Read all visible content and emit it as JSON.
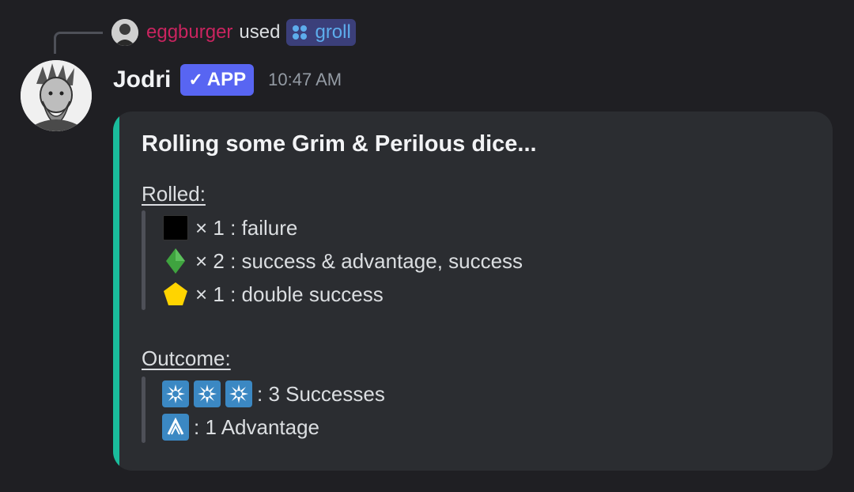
{
  "reply": {
    "username": "eggburger",
    "used_text": "used",
    "command": "groll",
    "user_color": "#c9245f",
    "command_color": "#5dadec"
  },
  "message": {
    "author": "Jodri",
    "badge": "APP",
    "badge_icon": "checkmark-icon",
    "timestamp": "10:47 AM"
  },
  "embed": {
    "accent_color": "#1abc9c",
    "title": "Rolling some Grim & Perilous dice...",
    "rolled_label": "Rolled:",
    "rolled": [
      {
        "die": "black-square-icon",
        "text": "× 1 : failure"
      },
      {
        "die": "green-diamond-icon",
        "text": "× 2 : success & advantage, success"
      },
      {
        "die": "yellow-pentagon-icon",
        "text": "× 1 : double success"
      }
    ],
    "outcome_label": "Outcome:",
    "outcome": [
      {
        "icons": [
          "success-star-icon",
          "success-star-icon",
          "success-star-icon"
        ],
        "text": ": 3 Successes"
      },
      {
        "icons": [
          "advantage-chevron-icon"
        ],
        "text": ": 1 Advantage"
      }
    ]
  }
}
